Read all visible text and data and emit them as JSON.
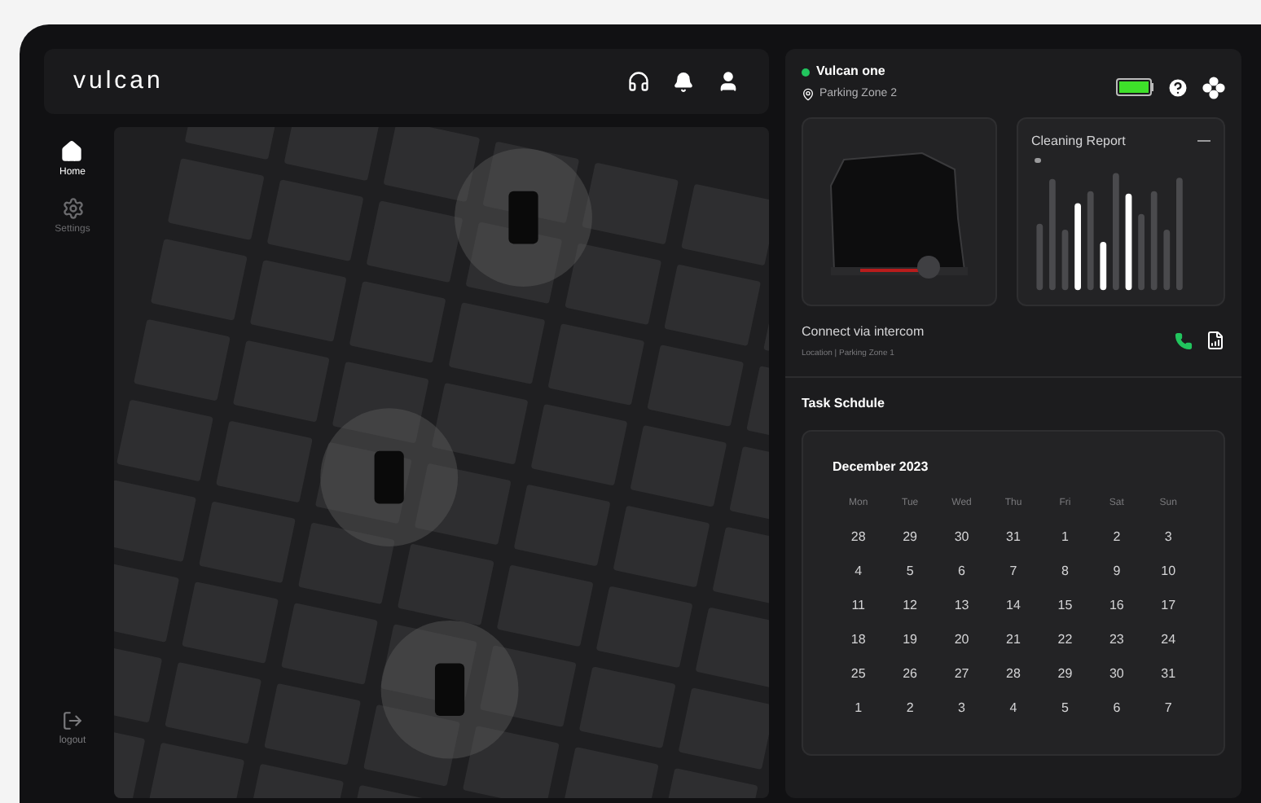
{
  "header": {
    "logo": "vulcan"
  },
  "nav": [
    {
      "label": "Home",
      "kind": "home",
      "selected": true
    },
    {
      "label": "Settings",
      "kind": "settings",
      "selected": false
    }
  ],
  "logout": {
    "label": "logout"
  },
  "robot": {
    "name": "Vulcan one",
    "location": "Parking Zone 2",
    "online": true,
    "battery": {
      "level": 1
    }
  },
  "report": {
    "title": "Cleaning Report"
  },
  "intercom": {
    "title": "Connect via intercom",
    "subtitle": "Location | Parking Zone 1"
  },
  "schedule": {
    "title": "Task Schdule",
    "month": "December 2023",
    "weekdays": [
      "Mon",
      "Tue",
      "Wed",
      "Thu",
      "Fri",
      "Sat",
      "Sun"
    ],
    "weeks": [
      [
        "28",
        "29",
        "30",
        "31",
        "1",
        "2",
        "3"
      ],
      [
        "4",
        "5",
        "6",
        "7",
        "8",
        "9",
        "10"
      ],
      [
        "11",
        "12",
        "13",
        "14",
        "15",
        "16",
        "17"
      ],
      [
        "18",
        "19",
        "20",
        "21",
        "22",
        "23",
        "24"
      ],
      [
        "25",
        "26",
        "27",
        "28",
        "29",
        "30",
        "31"
      ],
      [
        "1",
        "2",
        "3",
        "4",
        "5",
        "6",
        "7"
      ]
    ]
  }
}
